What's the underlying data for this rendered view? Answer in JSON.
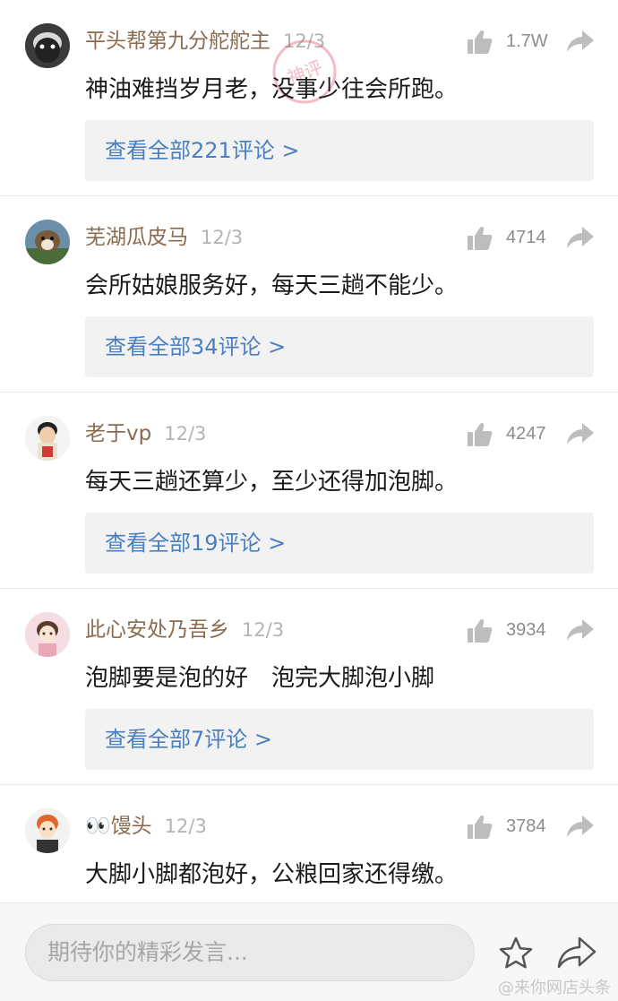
{
  "comments": [
    {
      "name": "平头帮第九分舵舵主",
      "time": "12/3",
      "likes": "1.7W",
      "text": "神油难挡岁月老，没事少往会所跑。",
      "replies": "查看全部221评论 >"
    },
    {
      "name": "芜湖瓜皮马",
      "time": "12/3",
      "likes": "4714",
      "text": "会所姑娘服务好，每天三趟不能少。",
      "replies": "查看全部34评论 >"
    },
    {
      "name": "老于vp",
      "time": "12/3",
      "likes": "4247",
      "text": "每天三趟还算少，至少还得加泡脚。",
      "replies": "查看全部19评论 >"
    },
    {
      "name": "此心安处乃吾乡",
      "time": "12/3",
      "likes": "3934",
      "text": "泡脚要是泡的好　泡完大脚泡小脚",
      "replies": "查看全部7评论 >"
    },
    {
      "name": "👀馒头",
      "time": "12/3",
      "likes": "3784",
      "text": "大脚小脚都泡好，公粮回家还得缴。"
    }
  ],
  "bottom": {
    "placeholder": "期待你的精彩发言...",
    "watermark": "@来你网店头条"
  },
  "stamp_text": "神评",
  "colors": {
    "username": "#8a6b4f",
    "link": "#4a7fc0",
    "text": "#1a1a1a",
    "meta": "#b3b3b3"
  },
  "icons": {
    "like": "thumbs-up-icon",
    "share": "share-arrow-icon",
    "favorite": "star-icon"
  }
}
